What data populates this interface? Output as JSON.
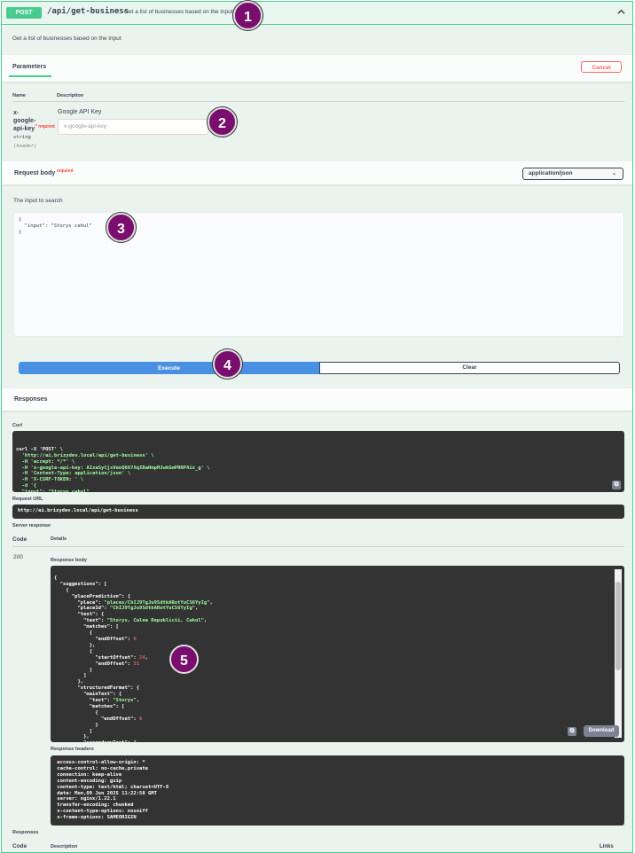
{
  "operation": {
    "method": "POST",
    "path": "/api/get-business",
    "summary": "Get a list of businesses based on the input",
    "description": "Get a list of businesses based on the input"
  },
  "parameters": {
    "tab_label": "Parameters",
    "cancel_label": "Cancel",
    "col_name": "Name",
    "col_description": "Description",
    "param": {
      "name": "x-google-api-key",
      "required_marker": "* required",
      "type": "string",
      "location": "(header)",
      "description": "Google API Key",
      "placeholder": "x-google-api-key"
    }
  },
  "request_body": {
    "label": "Request body",
    "required": "required",
    "content_type": "application/json",
    "input_description": "The input to search",
    "value": "{\n  \"input\": \"Storys cahul\"\n}"
  },
  "actions": {
    "execute": "Execute",
    "clear": "Clear"
  },
  "responses": {
    "title": "Responses",
    "curl_label": "Curl",
    "curl": [
      "curl -X 'POST' \\",
      "  'http://ai.brizydev.local/api/get-business' \\",
      "  -H 'accept: */*' \\",
      "  -H 'x-google-api-key: AIzaSyCjsVeoQ667XqIBaHmpMJwkGmPRNP4ix_g' \\",
      "  -H 'Content-Type: application/json' \\",
      "  -H 'X-CSRF-TOKEN: ' \\",
      "  -d '{",
      "  \"input\": \"Storys cahul\"",
      "}'"
    ],
    "request_url_label": "Request URL",
    "request_url": "http://ai.brizydev.local/api/get-business",
    "server_response_label": "Server response",
    "code_label": "Code",
    "details_label": "Details",
    "code": "200",
    "response_body_label": "Response body",
    "response_headers_label": "Response headers",
    "download_label": "Download",
    "response_headers": [
      " access-control-allow-origin: * ",
      " cache-control: no-cache,private ",
      " connection: keep-alive ",
      " content-encoding: gzip ",
      " content-type: text/html; charset=UTF-8 ",
      " date: Mon,09 Jun 2025 11:22:58 GMT ",
      " server: nginx/1.22.1 ",
      " transfer-encoding: chunked ",
      " x-content-type-options: nosniff ",
      " x-frame-options: SAMEORIGIN "
    ],
    "bottom_title": "Responses",
    "bottom_code": "Code",
    "bottom_description": "Description",
    "bottom_links": "Links"
  },
  "annotations": [
    "1",
    "2",
    "3",
    "4",
    "5"
  ],
  "colors": {
    "post": "#49cc90",
    "execute": "#4990e2",
    "cancel": "#ff6060",
    "badge": "#7a0e6e"
  }
}
